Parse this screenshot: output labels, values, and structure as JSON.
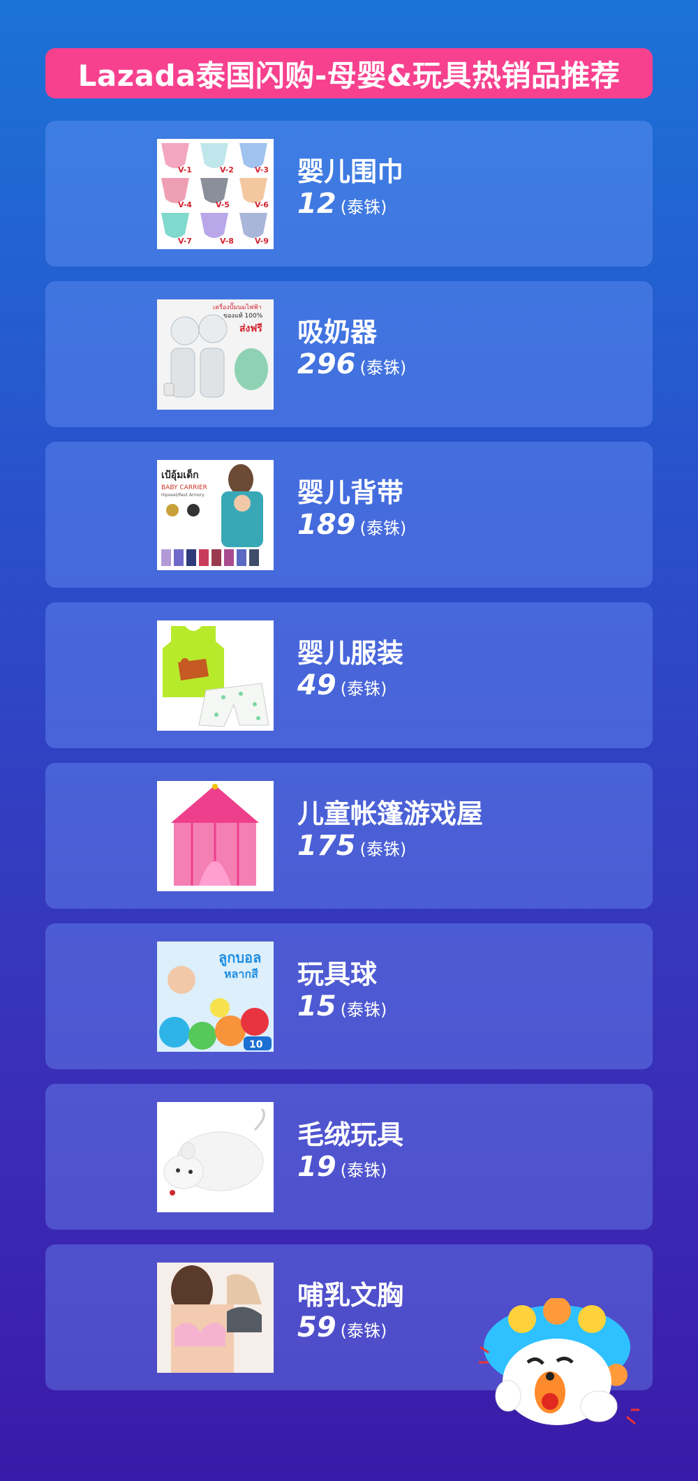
{
  "title": "Lazada泰国闪购-母婴&玩具热销品推荐",
  "products": [
    {
      "name": "婴儿围巾",
      "price": "12",
      "unit": "(泰铢)"
    },
    {
      "name": "吸奶器",
      "price": "296",
      "unit": "(泰铢)"
    },
    {
      "name": "婴儿背带",
      "price": "189",
      "unit": "(泰铢)"
    },
    {
      "name": "婴儿服装",
      "price": "49",
      "unit": "(泰铢)"
    },
    {
      "name": "儿童帐篷游戏屋",
      "price": "175",
      "unit": "(泰铢)"
    },
    {
      "name": "玩具球",
      "price": "15",
      "unit": "(泰铢)"
    },
    {
      "name": "毛绒玩具",
      "price": "19",
      "unit": "(泰铢)"
    },
    {
      "name": "哺乳文胸",
      "price": "59",
      "unit": "(泰铢)"
    }
  ],
  "thumb_texts": {
    "bib_labels": [
      "V-1",
      "V-2",
      "V-3",
      "V-4",
      "V-5",
      "V-6",
      "V-7",
      "V-8",
      "V-9"
    ],
    "pump_top": "เครื่องปั๊มนมไฟฟ้า",
    "pump_mid": "ของแท้ 100%",
    "pump_free": "ส่งฟรี",
    "carrier_th": "เป้อุ้มเด็ก",
    "carrier_en": "BABY CARRIER",
    "carrier_sub": "Hipseat/Rest Armory",
    "ball_th": "ลูกบอล",
    "ball_th2": "หลากสี",
    "ball_count": "10"
  },
  "colors": {
    "title_bg": "#f7418f",
    "card_bg": "rgba(120,160,255,0.35)"
  }
}
